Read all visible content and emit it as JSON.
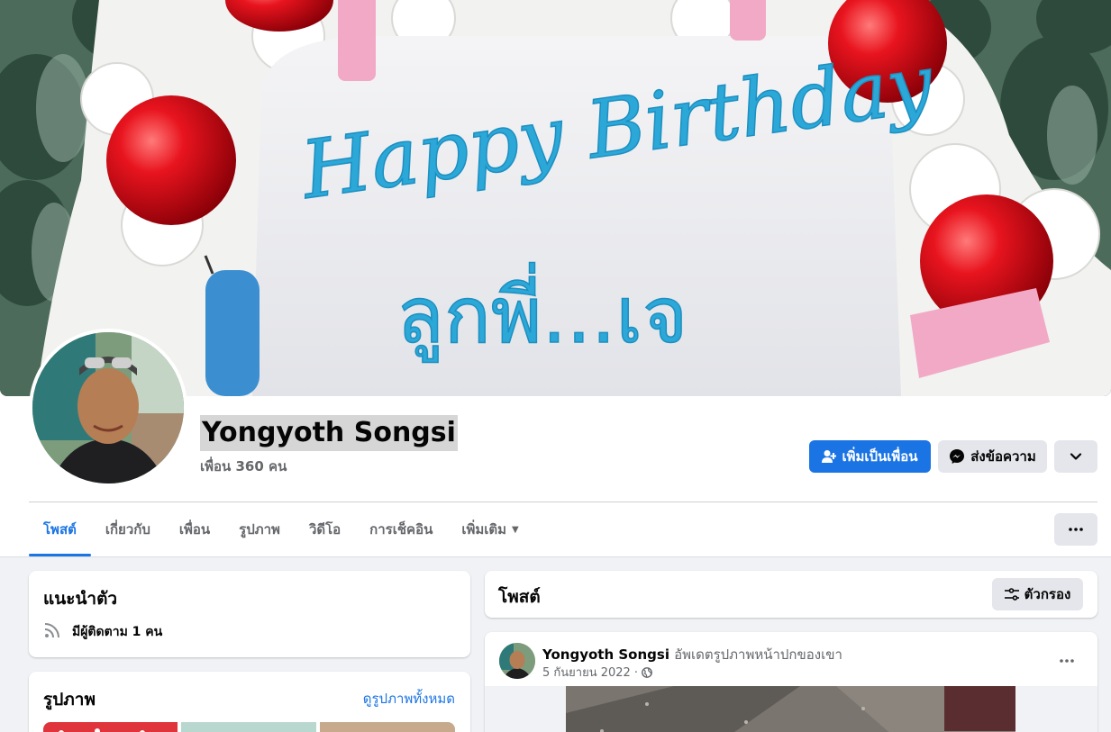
{
  "profile": {
    "name": "Yongyoth Songsi",
    "friends": "เพื่อน 360 คน"
  },
  "actions": {
    "add_friend": "เพิ่มเป็นเพื่อน",
    "message": "ส่งข้อความ"
  },
  "tabs": [
    {
      "label": "โพสต์",
      "active": true
    },
    {
      "label": "เกี่ยวกับ"
    },
    {
      "label": "เพื่อน"
    },
    {
      "label": "รูปภาพ"
    },
    {
      "label": "วิดีโอ"
    },
    {
      "label": "การเช็คอิน"
    },
    {
      "label": "เพิ่มเติม"
    }
  ],
  "intro": {
    "title": "แนะนำตัว",
    "followers": "มีผู้ติดตาม 1 คน"
  },
  "photos": {
    "title": "รูปภาพ",
    "see_all": "ดูรูปภาพทั้งหมด"
  },
  "posts_header": {
    "title": "โพสต์",
    "filter": "ตัวกรอง"
  },
  "post": {
    "author": "Yongyoth Songsi",
    "action": "อัพเดตรูปภาพหน้าปกของเขา",
    "date": "5 กันยายน 2022 ·"
  },
  "cover": {
    "cake_text_1": "Happy Birthday",
    "cake_text_2": "ลูกพี่...เจ"
  },
  "colors": {
    "accent": "#1b74e4",
    "page_bg": "#f0f2f5",
    "icing": "#2ba8d8"
  }
}
